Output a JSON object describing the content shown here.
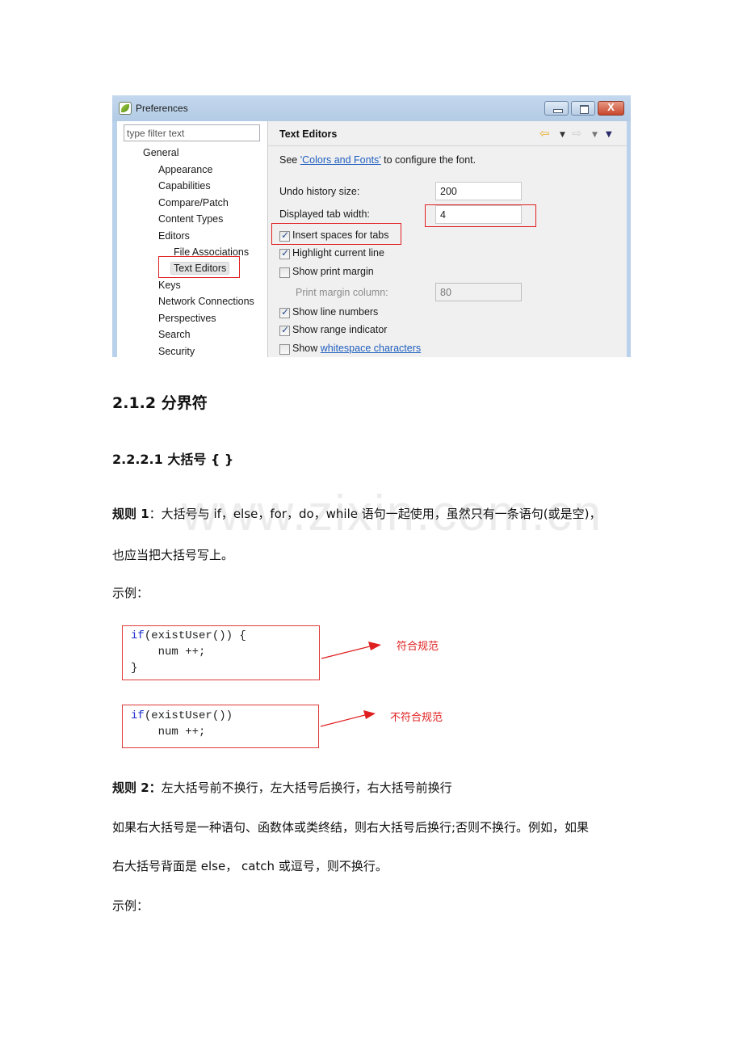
{
  "dialog": {
    "title": "Preferences",
    "window_controls": {
      "minimize": "minimize",
      "maximize": "maximize",
      "close": "X"
    },
    "filter": {
      "placeholder": "type filter text",
      "value": ""
    },
    "tree": [
      {
        "label": "General",
        "level": 0
      },
      {
        "label": "Appearance",
        "level": 1
      },
      {
        "label": "Capabilities",
        "level": 1
      },
      {
        "label": "Compare/Patch",
        "level": 1
      },
      {
        "label": "Content Types",
        "level": 1
      },
      {
        "label": "Editors",
        "level": 1
      },
      {
        "label": "File Associations",
        "level": 2
      },
      {
        "label": "Text Editors",
        "level": 2,
        "selected": true
      },
      {
        "label": "Keys",
        "level": 1
      },
      {
        "label": "Network Connections",
        "level": 1
      },
      {
        "label": "Perspectives",
        "level": 1
      },
      {
        "label": "Search",
        "level": 1
      },
      {
        "label": "Security",
        "level": 1
      }
    ],
    "page": {
      "title": "Text Editors",
      "nav": {
        "back": "back-arrow",
        "forward": "forward-arrow",
        "menu": "view-menu"
      },
      "intro_prefix": "See ",
      "intro_link": "'Colors and Fonts'",
      "intro_suffix": " to configure the font.",
      "undo_label": "Undo history size:",
      "undo_value": "200",
      "tab_width_label": "Displayed tab width:",
      "tab_width_value": "4",
      "print_margin_label": "Print margin column:",
      "print_margin_value": "80",
      "checkboxes": [
        {
          "label": "Insert spaces for tabs",
          "checked": true
        },
        {
          "label": "Highlight current line",
          "checked": true
        },
        {
          "label": "Show print margin",
          "checked": false
        },
        {
          "label": "Show line numbers",
          "checked": true
        },
        {
          "label": "Show range indicator",
          "checked": true
        }
      ],
      "whitespace_prefix": "Show ",
      "whitespace_link": "whitespace characters",
      "whitespace_checked": false
    }
  },
  "document": {
    "heading_2": "2.1.2  分界符",
    "heading_3": "2.2.2.1  大括号 {  }",
    "watermark": "www.zixin.com.cn",
    "rule1": {
      "label": "规则 1",
      "line1": "：大括号与 if，else，for，do，while 语句一起使用，虽然只有一条语句(或是空)，",
      "line2": "也应当把大括号写上。"
    },
    "example_label_1": "示例：",
    "example_good": {
      "lines": [
        "if(existUser()) {",
        "    num ++;",
        "}"
      ],
      "annotation": "符合规范"
    },
    "example_bad": {
      "lines": [
        "if(existUser())",
        "    num ++;"
      ],
      "annotation": "不符合规范"
    },
    "rule2": {
      "label": "规则 2：",
      "text": "左大括号前不换行，左大括号后换行，右大括号前换行"
    },
    "rule2_detail_line1": "如果右大括号是一种语句、函数体或类终结，则右大括号后换行;否则不换行。例如，如果",
    "rule2_detail_line2": "右大括号背面是 else，  catch 或逗号，则不换行。",
    "example_label_2": "示例：",
    "colors": {
      "highlight_red": "#e02020",
      "keyword_blue": "#2233cc",
      "link_blue": "#1f5fbf"
    }
  }
}
